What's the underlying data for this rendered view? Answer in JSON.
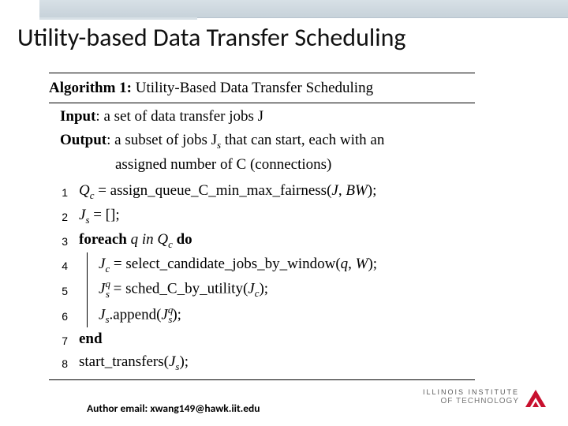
{
  "title": "Utility-based Data Transfer Scheduling",
  "algo": {
    "number_label": "Algorithm 1:",
    "name": "Utility-Based Data Transfer Scheduling",
    "input_label": "Input",
    "input_text": "a set of data transfer jobs J",
    "output_label": "Output",
    "output_text_a": "a subset of jobs J",
    "output_sub": "s",
    "output_text_b": " that can start, each with an",
    "output_text_c": "assigned number of C (connections)",
    "lines": {
      "n1": "1",
      "l1a": "Q",
      "l1sub": "c",
      "l1b": " = assign_queue_C_min_max_fairness(",
      "l1c": "J",
      "l1d": ", ",
      "l1e": "BW",
      "l1f": ");",
      "n2": "2",
      "l2a": "J",
      "l2sub": "s",
      "l2b": " = [];",
      "n3": "3",
      "l3a": "foreach",
      "l3b": " q ",
      "l3c": "in",
      "l3d": " Q",
      "l3subc": "c",
      "l3e": " ",
      "l3f": "do",
      "n4": "4",
      "l4a": "J",
      "l4sub": "c",
      "l4b": " = select_candidate_jobs_by_window(",
      "l4c": "q",
      "l4d": ", ",
      "l4e": "W",
      "l4f": ");",
      "n5": "5",
      "l5a": "J",
      "l5sup": "q",
      "l5sub": "s",
      "l5b": " = sched_C_by_utility(",
      "l5c": "J",
      "l5csub": "c",
      "l5d": ");",
      "n6": "6",
      "l6a": "J",
      "l6sub": "s",
      "l6b": ".append(",
      "l6c": "J",
      "l6csup": "q",
      "l6csub": "s",
      "l6d": ");",
      "n7": "7",
      "l7a": "end",
      "n8": "8",
      "l8a": "start_transfers(",
      "l8b": "J",
      "l8sub": "s",
      "l8c": ");"
    }
  },
  "footer": {
    "email_prefix": "Author email: ",
    "email": "xwang149@hawk.iit.edu",
    "iit_line1": "ILLINOIS INSTITUTE",
    "iit_line2": "OF TECHNOLOGY"
  }
}
